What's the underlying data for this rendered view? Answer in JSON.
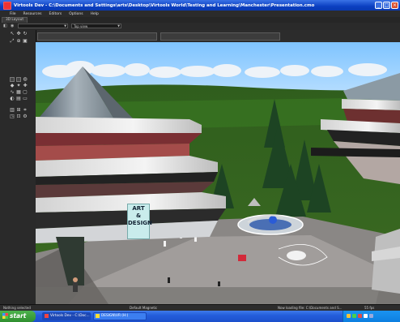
{
  "window": {
    "title": "Virtools Dev - C:\\Documents and Settings\\arts\\Desktop\\Virtools World\\Testing and Learning\\Manchester\\Presentation.cmo",
    "controls": [
      "minimize",
      "maximize",
      "close"
    ]
  },
  "menu": [
    "File",
    "Resources",
    "Editors",
    "Options",
    "Help"
  ],
  "tabs": [
    "3D Layout"
  ],
  "toolbar": {
    "left_icons": [
      "camera-icon",
      "eye-icon"
    ],
    "dropdown_1": "",
    "dropdown_2": "Top view"
  },
  "viewport": {
    "sign_lines": [
      "ART",
      "&",
      "DESIGN"
    ]
  },
  "status": {
    "left": "Nothing selected",
    "middle": "Default Magnetic",
    "loading": "Now loading file: C:\\Documents and S...",
    "fps": "55 fps"
  },
  "taskbar": {
    "start_label": "start",
    "items": [
      "Virtools Dev - C:\\Doc...",
      "DESIGN\\VR (H:)"
    ],
    "clock": ""
  },
  "colors": {
    "sky": "#86c9ff",
    "grass": "#2e5a1d",
    "title_bar": "#0b3fc1"
  }
}
